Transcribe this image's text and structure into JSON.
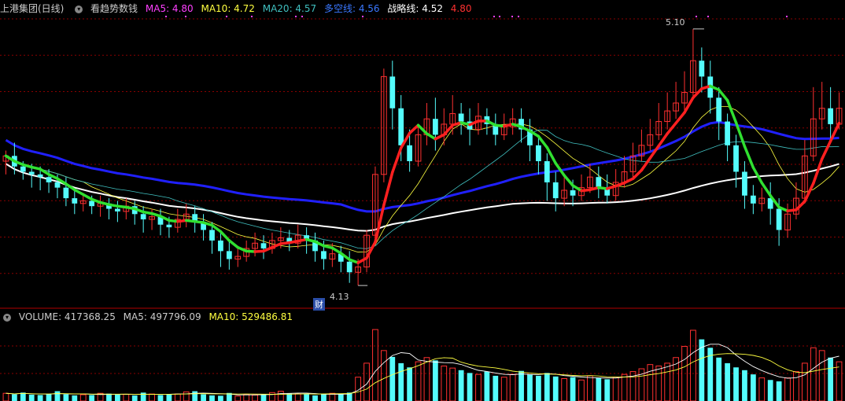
{
  "header": {
    "stock": "上港集团(日线)",
    "indicator": "看趋势数钱",
    "ma5": "MA5: 4.80",
    "ma10": "MA10: 4.72",
    "ma20": "MA20: 4.57",
    "duokong": "多空线: 4.56",
    "zhanlue": "战略线: 4.52",
    "extra": "4.80"
  },
  "volume_header": {
    "volume": "VOLUME: 417368.25",
    "ma5": "MA5: 497796.09",
    "ma10": "MA10: 529486.81"
  },
  "annotations": {
    "high": "5.10",
    "low": "4.13",
    "cai": "财"
  },
  "colors": {
    "up": "#ff3030",
    "down": "#54fcfc",
    "trend_up": "#ff2020",
    "trend_down": "#30e030",
    "blue_line": "#2020ff",
    "white_line": "#ffffff",
    "ma5": "#ffffff",
    "ma10": "#ffff40",
    "ma20": "#40c0c0",
    "grid": "#8a0000",
    "header_magenta": "#ff40ff",
    "header_yellow": "#ffff40",
    "header_cyan": "#40c0ff"
  },
  "chart_data": {
    "type": "candlestick",
    "price_range": [
      4.05,
      5.15
    ],
    "high": 5.1,
    "low": 4.13,
    "candles": [
      [
        4.6,
        4.62,
        4.55,
        4.64
      ],
      [
        4.62,
        4.58,
        4.55,
        4.67
      ],
      [
        4.58,
        4.56,
        4.53,
        4.6
      ],
      [
        4.56,
        4.55,
        4.5,
        4.59
      ],
      [
        4.55,
        4.54,
        4.49,
        4.58
      ],
      [
        4.54,
        4.52,
        4.48,
        4.57
      ],
      [
        4.52,
        4.5,
        4.46,
        4.55
      ],
      [
        4.5,
        4.46,
        4.43,
        4.54
      ],
      [
        4.46,
        4.44,
        4.4,
        4.49
      ],
      [
        4.44,
        4.45,
        4.41,
        4.48
      ],
      [
        4.45,
        4.43,
        4.4,
        4.47
      ],
      [
        4.43,
        4.44,
        4.39,
        4.47
      ],
      [
        4.44,
        4.42,
        4.38,
        4.46
      ],
      [
        4.42,
        4.41,
        4.37,
        4.45
      ],
      [
        4.41,
        4.43,
        4.38,
        4.46
      ],
      [
        4.43,
        4.4,
        4.36,
        4.45
      ],
      [
        4.4,
        4.38,
        4.33,
        4.43
      ],
      [
        4.38,
        4.39,
        4.34,
        4.42
      ],
      [
        4.39,
        4.36,
        4.32,
        4.42
      ],
      [
        4.36,
        4.35,
        4.31,
        4.39
      ],
      [
        4.35,
        4.38,
        4.33,
        4.42
      ],
      [
        4.38,
        4.4,
        4.35,
        4.44
      ],
      [
        4.4,
        4.37,
        4.33,
        4.43
      ],
      [
        4.37,
        4.34,
        4.3,
        4.4
      ],
      [
        4.34,
        4.3,
        4.25,
        4.37
      ],
      [
        4.3,
        4.26,
        4.2,
        4.34
      ],
      [
        4.26,
        4.23,
        4.19,
        4.3
      ],
      [
        4.23,
        4.24,
        4.2,
        4.28
      ],
      [
        4.24,
        4.27,
        4.22,
        4.3
      ],
      [
        4.27,
        4.29,
        4.24,
        4.33
      ],
      [
        4.29,
        4.27,
        4.23,
        4.32
      ],
      [
        4.27,
        4.3,
        4.25,
        4.33
      ],
      [
        4.3,
        4.31,
        4.27,
        4.35
      ],
      [
        4.31,
        4.29,
        4.26,
        4.34
      ],
      [
        4.29,
        4.32,
        4.27,
        4.36
      ],
      [
        4.32,
        4.3,
        4.25,
        4.35
      ],
      [
        4.3,
        4.26,
        4.22,
        4.33
      ],
      [
        4.26,
        4.23,
        4.19,
        4.3
      ],
      [
        4.23,
        4.25,
        4.2,
        4.29
      ],
      [
        4.25,
        4.22,
        4.18,
        4.28
      ],
      [
        4.22,
        4.18,
        4.14,
        4.26
      ],
      [
        4.18,
        4.2,
        4.13,
        4.23
      ],
      [
        4.2,
        4.32,
        4.18,
        4.34
      ],
      [
        4.32,
        4.55,
        4.3,
        4.58
      ],
      [
        4.55,
        4.92,
        4.52,
        4.95
      ],
      [
        4.92,
        4.8,
        4.72,
        4.98
      ],
      [
        4.8,
        4.66,
        4.6,
        4.85
      ],
      [
        4.66,
        4.6,
        4.56,
        4.72
      ],
      [
        4.6,
        4.7,
        4.58,
        4.74
      ],
      [
        4.7,
        4.76,
        4.66,
        4.82
      ],
      [
        4.76,
        4.7,
        4.64,
        4.84
      ],
      [
        4.7,
        4.74,
        4.66,
        4.8
      ],
      [
        4.74,
        4.78,
        4.7,
        4.85
      ],
      [
        4.78,
        4.75,
        4.7,
        4.82
      ],
      [
        4.75,
        4.72,
        4.66,
        4.8
      ],
      [
        4.72,
        4.77,
        4.7,
        4.82
      ],
      [
        4.77,
        4.74,
        4.7,
        4.8
      ],
      [
        4.74,
        4.7,
        4.66,
        4.78
      ],
      [
        4.7,
        4.73,
        4.68,
        4.78
      ],
      [
        4.73,
        4.76,
        4.7,
        4.8
      ],
      [
        4.76,
        4.72,
        4.67,
        4.8
      ],
      [
        4.72,
        4.66,
        4.6,
        4.76
      ],
      [
        4.66,
        4.6,
        4.55,
        4.7
      ],
      [
        4.6,
        4.52,
        4.45,
        4.63
      ],
      [
        4.52,
        4.46,
        4.41,
        4.56
      ],
      [
        4.46,
        4.49,
        4.43,
        4.54
      ],
      [
        4.49,
        4.47,
        4.43,
        4.53
      ],
      [
        4.47,
        4.5,
        4.45,
        4.55
      ],
      [
        4.5,
        4.54,
        4.48,
        4.59
      ],
      [
        4.54,
        4.5,
        4.46,
        4.58
      ],
      [
        4.5,
        4.47,
        4.44,
        4.55
      ],
      [
        4.47,
        4.52,
        4.45,
        4.57
      ],
      [
        4.52,
        4.56,
        4.5,
        4.62
      ],
      [
        4.56,
        4.62,
        4.54,
        4.67
      ],
      [
        4.62,
        4.66,
        4.6,
        4.72
      ],
      [
        4.66,
        4.7,
        4.64,
        4.76
      ],
      [
        4.7,
        4.75,
        4.68,
        4.82
      ],
      [
        4.75,
        4.79,
        4.72,
        4.86
      ],
      [
        4.79,
        4.82,
        4.76,
        4.9
      ],
      [
        4.82,
        4.86,
        4.78,
        4.94
      ],
      [
        4.86,
        4.98,
        4.84,
        5.1
      ],
      [
        4.98,
        4.92,
        4.86,
        5.03
      ],
      [
        4.92,
        4.84,
        4.78,
        4.98
      ],
      [
        4.84,
        4.75,
        4.68,
        4.88
      ],
      [
        4.75,
        4.66,
        4.6,
        4.78
      ],
      [
        4.66,
        4.56,
        4.5,
        4.7
      ],
      [
        4.56,
        4.47,
        4.42,
        4.6
      ],
      [
        4.47,
        4.44,
        4.4,
        4.51
      ],
      [
        4.44,
        4.46,
        4.41,
        4.5
      ],
      [
        4.46,
        4.42,
        4.36,
        4.52
      ],
      [
        4.42,
        4.34,
        4.28,
        4.46
      ],
      [
        4.34,
        4.4,
        4.31,
        4.44
      ],
      [
        4.4,
        4.46,
        4.38,
        4.52
      ],
      [
        4.46,
        4.62,
        4.44,
        4.68
      ],
      [
        4.62,
        4.76,
        4.6,
        4.88
      ],
      [
        4.76,
        4.8,
        4.72,
        4.9
      ],
      [
        4.8,
        4.74,
        4.68,
        4.88
      ],
      [
        4.74,
        4.8,
        4.72,
        4.86
      ]
    ],
    "volume_range": [
      0,
      1100000
    ],
    "volumes": [
      110000,
      95000,
      120000,
      90000,
      85000,
      100000,
      140000,
      95000,
      80000,
      90000,
      85000,
      110000,
      105000,
      90000,
      95000,
      80000,
      120000,
      100000,
      85000,
      95000,
      100000,
      130000,
      140000,
      95000,
      80000,
      75000,
      115000,
      70000,
      95000,
      85000,
      90000,
      120000,
      140000,
      110000,
      100000,
      95000,
      80000,
      100000,
      110000,
      95000,
      120000,
      340000,
      540000,
      1020000,
      720000,
      630000,
      540000,
      480000,
      560000,
      620000,
      580000,
      500000,
      470000,
      440000,
      400000,
      380000,
      420000,
      360000,
      340000,
      380000,
      430000,
      380000,
      360000,
      400000,
      350000,
      320000,
      340000,
      300000,
      360000,
      330000,
      310000,
      340000,
      380000,
      420000,
      460000,
      520000,
      500000,
      540000,
      620000,
      780000,
      1010000,
      880000,
      760000,
      620000,
      540000,
      480000,
      440000,
      380000,
      330000,
      300000,
      280000,
      330000,
      420000,
      540000,
      760000,
      720000,
      620000,
      560000
    ],
    "volume_ma5_series": true
  }
}
